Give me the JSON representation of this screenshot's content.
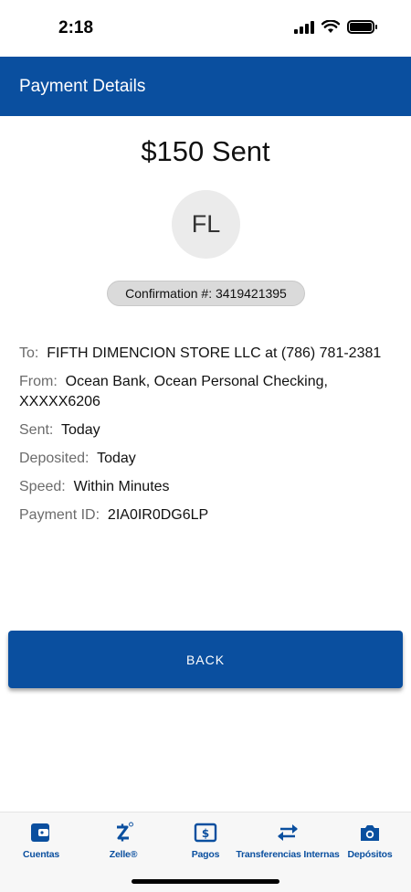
{
  "status_bar": {
    "time": "2:18"
  },
  "header": {
    "title": "Payment Details"
  },
  "payment": {
    "amount_text": "$150 Sent",
    "avatar_initials": "FL",
    "confirmation": "Confirmation #: 3419421395"
  },
  "details": {
    "to_label": "To:",
    "to_value": "FIFTH DIMENCION STORE LLC at (786) 781-2381",
    "from_label": "From:",
    "from_value": "Ocean Bank, Ocean Personal Checking, XXXXX6206",
    "sent_label": "Sent:",
    "sent_value": "Today",
    "deposited_label": "Deposited:",
    "deposited_value": "Today",
    "speed_label": "Speed:",
    "speed_value": "Within Minutes",
    "payment_id_label": "Payment ID:",
    "payment_id_value": "2IA0IR0DG6LP"
  },
  "actions": {
    "back_label": "BACK"
  },
  "tabbar": {
    "items": [
      {
        "label": "Cuentas",
        "icon": "wallet-icon"
      },
      {
        "label": "Zelle®",
        "icon": "zelle-icon"
      },
      {
        "label": "Pagos",
        "icon": "bill-icon"
      },
      {
        "label": "Transferencias Internas",
        "icon": "transfer-icon"
      },
      {
        "label": "Depósitos",
        "icon": "camera-icon"
      }
    ]
  },
  "colors": {
    "brand_blue": "#0a4f9f",
    "pill_gray": "#dadada",
    "avatar_gray": "#ebebeb"
  }
}
